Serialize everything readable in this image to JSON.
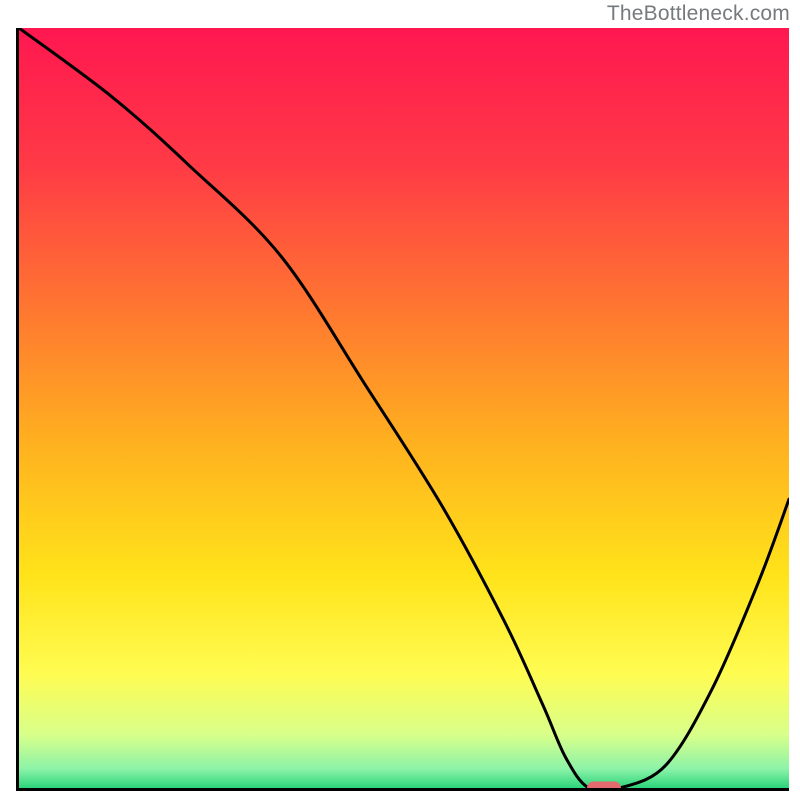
{
  "watermark": "TheBottleneck.com",
  "colors": {
    "axis": "#000000",
    "curve": "#000000",
    "marker": "#e46a6f",
    "gradient_stops": [
      {
        "offset": 0.0,
        "color": "#ff1750"
      },
      {
        "offset": 0.18,
        "color": "#ff3a46"
      },
      {
        "offset": 0.38,
        "color": "#ff7a2f"
      },
      {
        "offset": 0.55,
        "color": "#ffb21f"
      },
      {
        "offset": 0.72,
        "color": "#ffe31a"
      },
      {
        "offset": 0.85,
        "color": "#fffc52"
      },
      {
        "offset": 0.93,
        "color": "#d8ff8a"
      },
      {
        "offset": 0.975,
        "color": "#8cf3a8"
      },
      {
        "offset": 1.0,
        "color": "#2dd47a"
      }
    ]
  },
  "chart_data": {
    "type": "line",
    "title": "",
    "xlabel": "",
    "ylabel": "",
    "xlim": [
      0,
      100
    ],
    "ylim": [
      0,
      100
    ],
    "series": [
      {
        "name": "curve",
        "x": [
          0,
          12,
          22,
          34,
          45,
          55,
          63,
          68,
          71,
          74,
          78,
          84,
          90,
          96,
          100
        ],
        "y": [
          100,
          91,
          82,
          70,
          53,
          37,
          22,
          11,
          4,
          0,
          0,
          3,
          13,
          27,
          38
        ]
      }
    ],
    "marker": {
      "x": 76,
      "y": 0
    },
    "note": "x and y are in percent of the plot area; (0,0) is bottom-left, (100,100) is top-left of the gradient. Values are estimated from the image pixels."
  }
}
